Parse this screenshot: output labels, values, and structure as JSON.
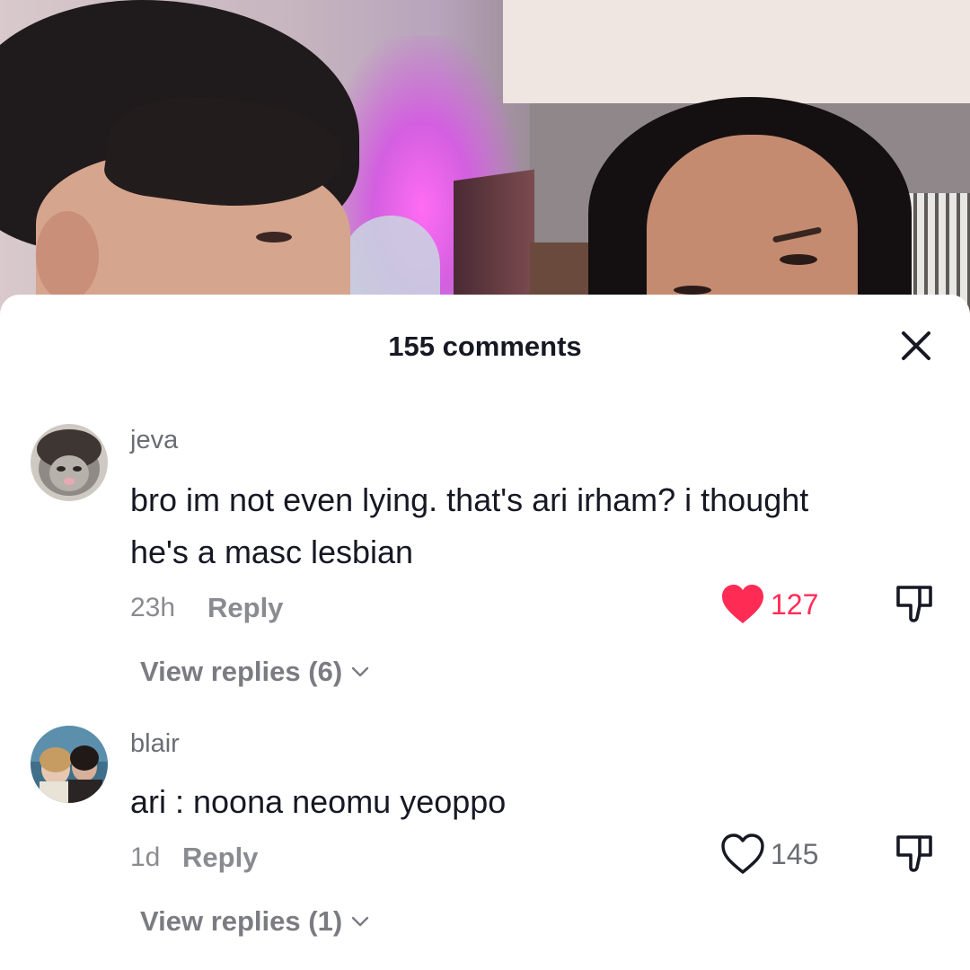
{
  "sheet": {
    "title": "155 comments"
  },
  "comments": [
    {
      "username": "jeva",
      "text_line1": "bro im not even lying. that's ari irham? i thought",
      "text_line2": "he's a masc lesbian",
      "time": "23h",
      "reply_label": "Reply",
      "likes": "127",
      "liked": true,
      "view_replies": "View replies (6)",
      "avatar_icon": "cat-avatar-icon"
    },
    {
      "username": "blair",
      "text_line1": "ari : noona neomu yeoppo",
      "time": "1d",
      "reply_label": "Reply",
      "likes": "145",
      "liked": false,
      "view_replies": "View replies (1)",
      "avatar_icon": "photo-avatar-icon"
    }
  ],
  "colors": {
    "like_active": "#fe2c55",
    "text_primary": "#161823",
    "text_secondary": "#8a8b91"
  }
}
